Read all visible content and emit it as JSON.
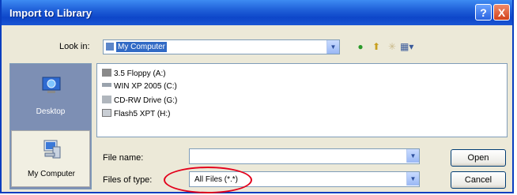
{
  "window": {
    "title": "Import to Library",
    "help_glyph": "?",
    "close_glyph": "X"
  },
  "lookin": {
    "label": "Look in:",
    "value": "My Computer"
  },
  "toolbar": {
    "icons": [
      "back-icon",
      "up-folder-icon",
      "new-folder-icon",
      "views-menu-icon"
    ]
  },
  "places": [
    {
      "label": "Desktop",
      "icon": "desktop-icon"
    },
    {
      "label": "My Computer",
      "icon": "my-computer-icon"
    }
  ],
  "files": [
    {
      "name": "3.5 Floppy (A:)",
      "icon": "floppy-drive-icon"
    },
    {
      "name": "WIN XP 2005 (C:)",
      "icon": "hard-drive-icon"
    },
    {
      "name": "CD-RW Drive (G:)",
      "icon": "cd-drive-icon"
    },
    {
      "name": "Flash5 XPT (H:)",
      "icon": "removable-drive-icon"
    }
  ],
  "filename": {
    "label": "File name:",
    "value": ""
  },
  "filetype": {
    "label": "Files of type:",
    "value": "All Files (*.*)"
  },
  "buttons": {
    "open": "Open",
    "cancel": "Cancel"
  },
  "colors": {
    "titlebar": "#0d46c9",
    "highlight": "#316ac5",
    "annotation_ring": "#e3001b"
  }
}
